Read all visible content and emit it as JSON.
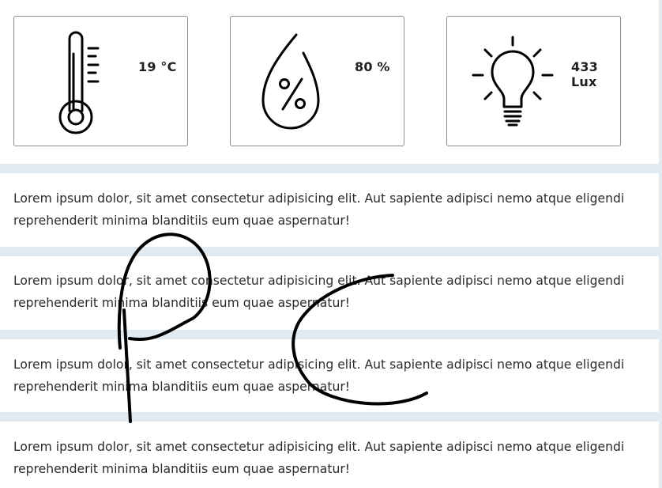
{
  "sensors": [
    {
      "icon": "thermometer-icon",
      "value": "19 °C"
    },
    {
      "icon": "humidity-drop-icon",
      "value": "80 %"
    },
    {
      "icon": "lightbulb-icon",
      "value": "433 Lux"
    }
  ],
  "paragraphs": [
    "Lorem ipsum dolor, sit amet consectetur adipisicing elit. Aut sapiente adipisci nemo atque eligendi reprehenderit minima blanditiis eum quae aspernatur!",
    "Lorem ipsum dolor, sit amet consectetur adipisicing elit. Aut sapiente adipisci nemo atque eligendi reprehenderit minima blanditiis eum quae aspernatur!",
    "Lorem ipsum dolor, sit amet consectetur adipisicing elit. Aut sapiente adipisci nemo atque eligendi reprehenderit minima blanditiis eum quae aspernatur!",
    "Lorem ipsum dolor, sit amet consectetur adipisicing elit. Aut sapiente adipisci nemo atque eligendi reprehenderit minima blanditiis eum quae aspernatur!"
  ],
  "annotation": {
    "text": "PC",
    "color": "#000000"
  },
  "colors": {
    "band": "#e2eaf1",
    "text": "#2b2b2b",
    "card_border": "#8d8d8d"
  }
}
